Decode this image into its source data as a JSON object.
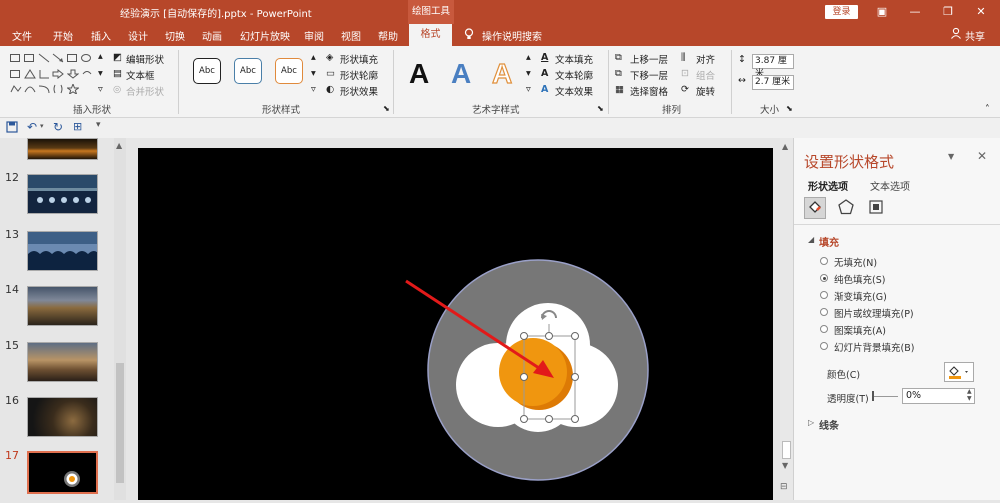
{
  "titlebar": {
    "doc_title": "经验演示 [自动保存的].pptx - PowerPoint",
    "context_tab": "绘图工具",
    "login": "登录",
    "minimize": "—",
    "restore": "❐",
    "close": "✕",
    "ribbon_display": "▣"
  },
  "tabs": {
    "file": "文件",
    "home": "开始",
    "insert": "插入",
    "design": "设计",
    "transitions": "切换",
    "animations": "动画",
    "slideshow": "幻灯片放映",
    "review": "审阅",
    "view": "视图",
    "help": "帮助",
    "format": "格式",
    "tell_me": "操作说明搜索",
    "share": "共享"
  },
  "ribbon": {
    "insert_shapes": {
      "label": "插入形状",
      "edit_shape": "编辑形状",
      "text_box": "文本框",
      "merge_shapes": "合并形状"
    },
    "shape_styles": {
      "label": "形状样式",
      "style1": "Abc",
      "style2": "Abc",
      "style3": "Abc",
      "fill": "形状填充",
      "outline": "形状轮廓",
      "effects": "形状效果"
    },
    "wordart": {
      "label": "艺术字样式",
      "sample": "A",
      "text_fill": "文本填充",
      "text_outline": "文本轮廓",
      "text_effects": "文本效果"
    },
    "arrange": {
      "label": "排列",
      "bring_forward": "上移一层",
      "send_backward": "下移一层",
      "selection_pane": "选择窗格",
      "align": "对齐",
      "group": "组合",
      "rotate": "旋转"
    },
    "size": {
      "label": "大小",
      "height": "3.87 厘米",
      "width": "2.7 厘米"
    }
  },
  "slides": {
    "numbers": [
      "12",
      "13",
      "14",
      "15",
      "16",
      "17"
    ]
  },
  "pane": {
    "title": "设置形状格式",
    "tab_shape": "形状选项",
    "tab_text": "文本选项",
    "section_fill": "填充",
    "options": [
      "无填充(N)",
      "纯色填充(S)",
      "渐变填充(G)",
      "图片或纹理填充(P)",
      "图案填充(A)",
      "幻灯片背景填充(B)"
    ],
    "selected_index": 1,
    "color_label": "颜色(C)",
    "transparency_label": "透明度(T)",
    "transparency_value": "0%",
    "section_line": "线条"
  },
  "colors": {
    "accent": "#b7472a",
    "yolk": "#f0960f",
    "yolk_dark": "#dd7a05",
    "plate": "#777777"
  }
}
